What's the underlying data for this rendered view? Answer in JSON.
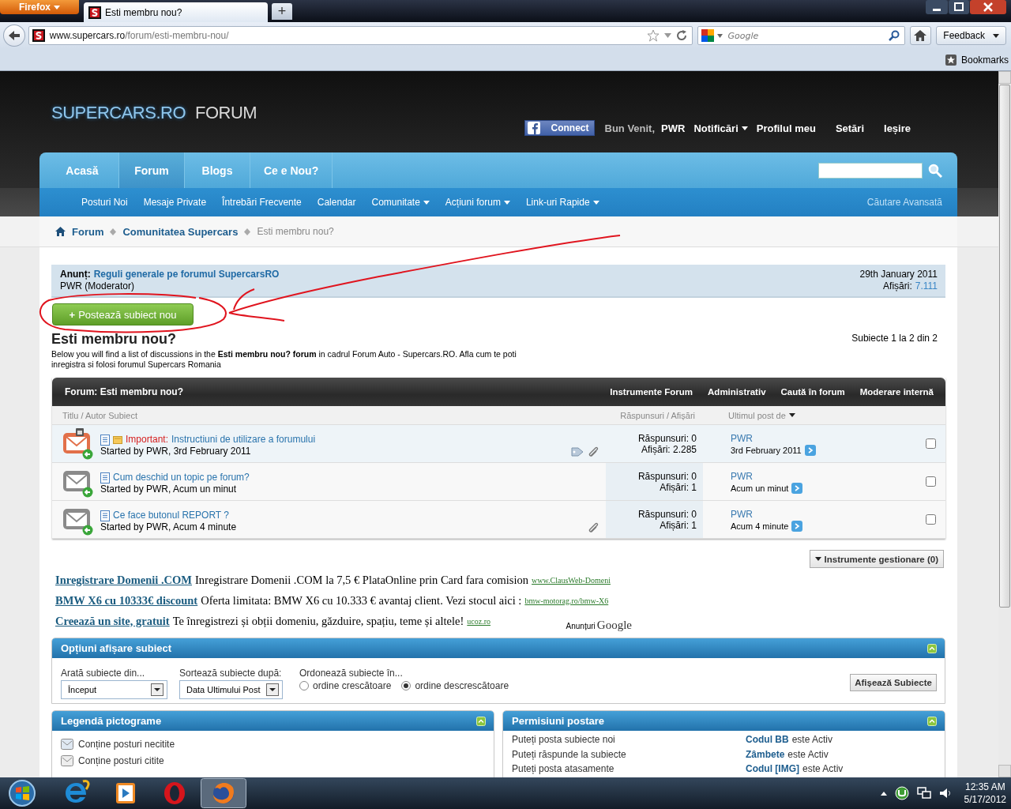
{
  "browser": {
    "menu_button": "Firefox",
    "tabs": [
      {
        "title": "Esti membru nou?",
        "selected": true
      }
    ],
    "new_tab": "+",
    "url": {
      "host": "www.supercars.ro",
      "path": "/forum/esti-membru-nou/"
    },
    "search": {
      "placeholder": "Google"
    },
    "feedback": "Feedback",
    "bookmarks": "Bookmarks"
  },
  "header": {
    "logo_main": "SUPERCARS.RO",
    "logo_sub": "FORUM",
    "connect": "Connect",
    "welcome": "Bun Venit,",
    "user": "PWR",
    "links": [
      {
        "label": "Notificări",
        "dropdown": true
      },
      {
        "label": "Profilul meu",
        "dropdown": false
      },
      {
        "label": "Setări",
        "dropdown": false
      },
      {
        "label": "Ieșire",
        "dropdown": false
      }
    ]
  },
  "main_tabs": [
    {
      "label": "Acasă",
      "selected": false
    },
    {
      "label": "Forum",
      "selected": true
    },
    {
      "label": "Blogs",
      "selected": false
    },
    {
      "label": "Ce e Nou?",
      "selected": false
    }
  ],
  "sub_nav": [
    {
      "label": "Posturi Noi",
      "dropdown": false
    },
    {
      "label": "Mesaje Private",
      "dropdown": false
    },
    {
      "label": "Întrebări Frecvente",
      "dropdown": false
    },
    {
      "label": "Calendar",
      "dropdown": false
    },
    {
      "label": "Comunitate",
      "dropdown": true
    },
    {
      "label": "Acțiuni forum",
      "dropdown": true
    },
    {
      "label": "Link-uri Rapide",
      "dropdown": true
    }
  ],
  "advanced_search": "Căutare Avansată",
  "breadcrumb": [
    {
      "label": "Forum",
      "current": false
    },
    {
      "label": "Comunitatea Supercars",
      "current": false
    },
    {
      "label": "Esti membru nou?",
      "current": true
    }
  ],
  "announcement": {
    "label": "Anunț:",
    "title": "Reguli generale pe forumul SupercarsRO",
    "author": "PWR (Moderator)",
    "date": "29th January 2011",
    "views_label": "Afișări:",
    "views": "7.111"
  },
  "new_topic": {
    "icon": "+",
    "label": "Postează subiect nou"
  },
  "forum": {
    "title": "Esti membru nou?",
    "pagination": "Subiecte 1 la 2 din 2",
    "description": "Below you will find a list of discussions in the **Esti membru nou? forum** in cadrul Forum Auto - Supercars.RO. Afla cum te poti inregistra si folosi forumul Supercars Romania"
  },
  "thread_table": {
    "title": "Forum: Esti membru nou?",
    "tools": [
      "Instrumente Forum",
      "Administrativ",
      "Caută în forum",
      "Moderare internă"
    ],
    "columns": [
      "Titlu / Autor Subiect",
      "Răspunsuri / Afișări",
      "Ultimul post de"
    ],
    "rows": [
      {
        "kind": "sticky",
        "prefix": "Important:",
        "title": "Instructiuni de utilizare a forumului",
        "started": "Started by PWR, 3rd February 2011",
        "replies": "Răspunsuri: 0",
        "views": "Afișări: 2.285",
        "last_user": "PWR",
        "last_time": "3rd February 2011",
        "tagged": true,
        "attachment": true,
        "checked": false
      },
      {
        "kind": "normal",
        "title": "Cum deschid un topic pe forum?",
        "started": "Started by PWR, Acum un minut",
        "replies": "Răspunsuri: 0",
        "views": "Afișări: 1",
        "last_user": "PWR",
        "last_time": "Acum un minut",
        "tagged": false,
        "attachment": false,
        "checked": false
      },
      {
        "kind": "normal",
        "title": "Ce face butonul REPORT ?",
        "started": "Started by PWR, Acum 4 minute",
        "replies": "Răspunsuri: 0",
        "views": "Afișări: 1",
        "last_user": "PWR",
        "last_time": "Acum 4 minute",
        "tagged": false,
        "attachment": true,
        "checked": false
      }
    ]
  },
  "manage_button": "Instrumente gestionare (0)",
  "ads": [
    {
      "title": "Inregistrare Domenii .COM",
      "text": "Inregistrare Domenii .COM la 7,5 € PlataOnline prin Card fara comision",
      "url": "www.ClausWeb-Domeni"
    },
    {
      "title": "BMW X6 cu 10333€ discount",
      "text": "Oferta limitata: BMW X6 cu 10.333 € avantaj client. Vezi stocul aici :",
      "url": "bmw-motorag.ro/bmw-X6"
    },
    {
      "title": "Creează un site, gratuit",
      "text": "Te înregistrezi și obții domeniu, găzduire, spațiu, teme și altele!",
      "url": "ucoz.ro"
    }
  ],
  "ads_label": "Anunțuri",
  "ads_brand": "Google",
  "display_options": {
    "title": "Opțiuni afișare subiect",
    "fields": [
      {
        "label": "Arată subiecte din...",
        "value": "Început"
      },
      {
        "label": "Sortează subiecte după:",
        "value": "Data Ultimului Post"
      }
    ],
    "order_label": "Ordonează subiecte în...",
    "order": [
      {
        "label": "ordine crescătoare",
        "selected": false
      },
      {
        "label": "ordine descrescătoare",
        "selected": true
      }
    ],
    "submit": "Afișează Subiecte"
  },
  "legend": {
    "title": "Legendă pictograme",
    "items": [
      "Conține posturi necitite",
      "Conține posturi citite"
    ]
  },
  "permissions": {
    "title": "Permisiuni postare",
    "items": [
      "Puteți posta subiecte noi",
      "Puteți răspunde la subiecte",
      "Puteți posta atasamente"
    ],
    "settings": [
      {
        "name": "Codul BB",
        "status": "este Activ"
      },
      {
        "name": "Zâmbete",
        "status": "este Activ"
      },
      {
        "name": "Codul [IMG]",
        "status": "este Activ"
      }
    ]
  },
  "annotation": {
    "kind": "circle-arrow"
  },
  "taskbar": {
    "apps": [
      {
        "kind": "ie",
        "active": false
      },
      {
        "kind": "media",
        "active": false
      },
      {
        "kind": "opera",
        "active": false
      },
      {
        "kind": "firefox",
        "active": true
      }
    ],
    "time": "12:35 AM",
    "date": "5/17/2012"
  }
}
